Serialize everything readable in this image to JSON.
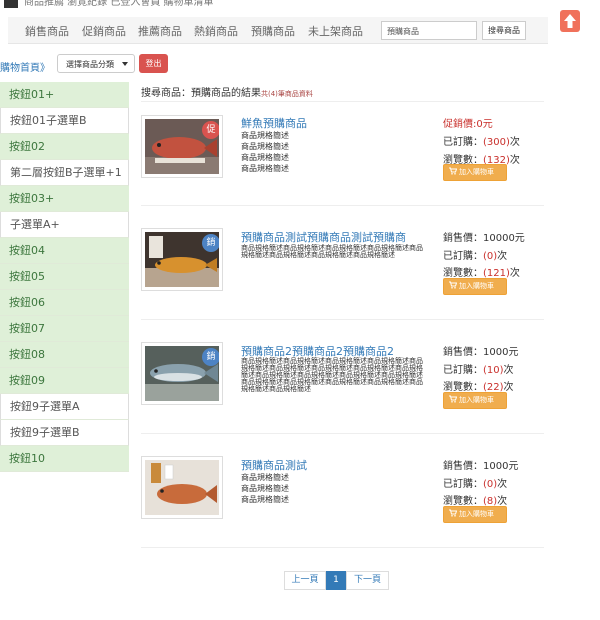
{
  "topline": {
    "text": "商品推薦 瀏覽紀錄 已登入會員 購物車清單"
  },
  "nav": {
    "items": [
      "銷售商品",
      "促銷商品",
      "推薦商品",
      "熱銷商品",
      "預購商品",
      "未上架商品"
    ],
    "search_value": "預購商品",
    "search_button": "搜尋商品"
  },
  "breadcrumb": {
    "home": "購物首頁",
    "sep": "》"
  },
  "category_select": {
    "value": "選擇商品分類"
  },
  "logout_label": "登出",
  "sidebar": {
    "items": [
      {
        "label": "按鈕01+",
        "style": "green"
      },
      {
        "label": "按鈕01子選單B",
        "style": "white"
      },
      {
        "label": "按鈕02",
        "style": "green"
      },
      {
        "label": "第二層按鈕B子選單+1",
        "style": "white"
      },
      {
        "label": "按鈕03+",
        "style": "green"
      },
      {
        "label": "子選單A+",
        "style": "white"
      },
      {
        "label": "按鈕04",
        "style": "green"
      },
      {
        "label": "按鈕05",
        "style": "green"
      },
      {
        "label": "按鈕06",
        "style": "green"
      },
      {
        "label": "按鈕07",
        "style": "green"
      },
      {
        "label": "按鈕08",
        "style": "green"
      },
      {
        "label": "按鈕09",
        "style": "green"
      },
      {
        "label": "按鈕9子選單A",
        "style": "white"
      },
      {
        "label": "按鈕9子選單B",
        "style": "white"
      },
      {
        "label": "按鈕10",
        "style": "green"
      }
    ]
  },
  "results": {
    "heading": "搜尋商品：預購商品的結果",
    "count": "共(4)筆商品資料"
  },
  "products": [
    {
      "title": "鮮魚預購商品",
      "badge": "促",
      "badge_color": "red",
      "specs": [
        "商品規格簡述",
        "商品規格簡述",
        "商品規格簡述",
        "商品規格簡述"
      ],
      "price_label": "促銷價:0元",
      "price_red": true,
      "order_label": "已訂購：",
      "order_count": "(300)",
      "order_unit": "次",
      "views_label": "瀏覽數：",
      "views_count": "(132)",
      "views_unit": "次",
      "cart_label": "加入購物車"
    },
    {
      "title": "預購商品測試預購商品測試預購商",
      "badge": "銷",
      "badge_color": "blue",
      "specs_dense": "商品規格簡述商品規格簡述商品規格簡述商品規格簡述商品規格簡述商品規格簡述商品規格簡述商品規格簡述",
      "price_label": "銷售價：10000元",
      "price_red": false,
      "order_label": "已訂購：",
      "order_count": "(0)",
      "order_unit": "次",
      "views_label": "瀏覽數：",
      "views_count": "(121)",
      "views_unit": "次",
      "cart_label": "加入購物車"
    },
    {
      "title": "預購商品2預購商品2預購商品2",
      "badge": "銷",
      "badge_color": "blue",
      "specs_dense": "商品規格簡述商品規格簡述商品規格簡述商品規格簡述商品規格簡述商品規格簡述商品規格簡述商品規格簡述商品規格簡述商品規格簡述商品規格簡述商品規格簡述商品規格簡述商品規格簡述商品規格簡述商品規格簡述商品規格簡述商品規格簡述商品規格簡述",
      "price_label": "銷售價：1000元",
      "price_red": false,
      "order_label": "已訂購：",
      "order_count": "(10)",
      "order_unit": "次",
      "views_label": "瀏覽數：",
      "views_count": "(22)",
      "views_unit": "次",
      "cart_label": "加入購物車"
    },
    {
      "title": "預購商品測試",
      "badge": "",
      "badge_color": "",
      "specs": [
        "商品規格簡述",
        "商品規格簡述",
        "商品規格簡述"
      ],
      "price_label": "銷售價：1000元",
      "price_red": false,
      "order_label": "已訂購：",
      "order_count": "(0)",
      "order_unit": "次",
      "views_label": "瀏覽數：",
      "views_count": "(8)",
      "views_unit": "次",
      "cart_label": "加入購物車"
    }
  ],
  "pagination": {
    "prev": "上一頁",
    "current": "1",
    "next": "下一頁"
  },
  "colors": {
    "accent_blue": "#337ab7",
    "sidebar_green": "#dff0d8",
    "sidebar_green_text": "#3c763d",
    "cart_orange": "#f0ad4e",
    "logout_red": "#d9534f",
    "price_red": "#c9302c"
  },
  "icons": [
    "arrow-up-icon",
    "caret-down-icon",
    "shopping-cart-icon"
  ]
}
